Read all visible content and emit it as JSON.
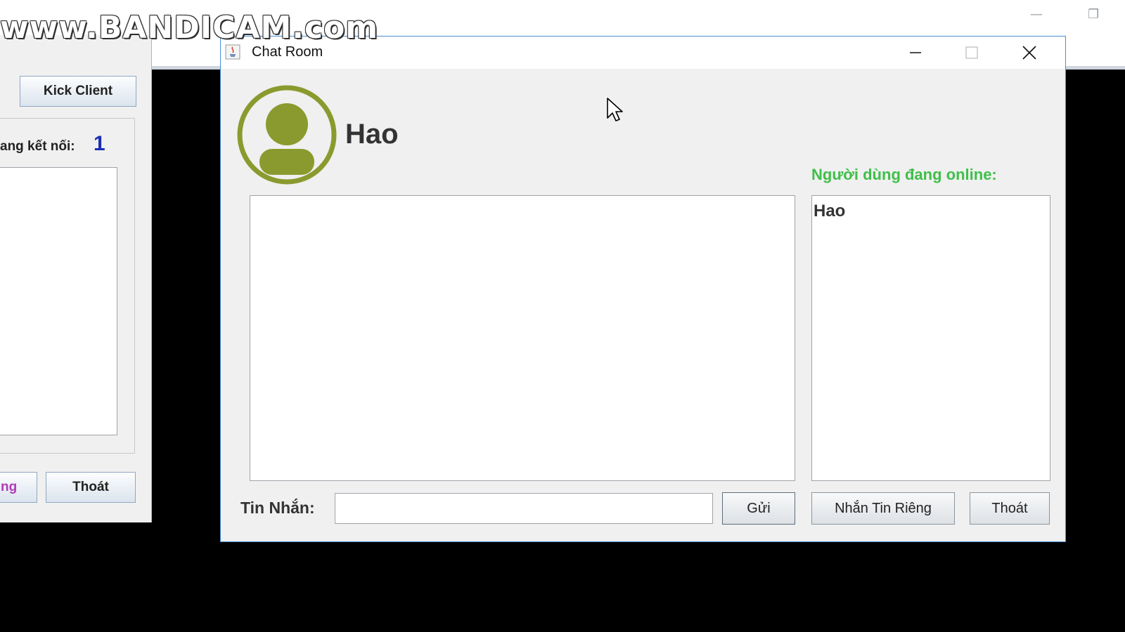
{
  "watermark": "www.BANDICAM.com",
  "background_window": {
    "minimize_glyph": "—",
    "restore_glyph": "❐"
  },
  "server_window": {
    "kick_button": "Kick Client",
    "connected_label": "ang kết nối:",
    "connected_count": "1",
    "partial_button": "ng",
    "exit_button": "Thoát"
  },
  "chat_window": {
    "title": "Chat Room",
    "username": "Hao",
    "online_title": "Người dùng đang online:",
    "online_users": [
      "Hao"
    ],
    "message_label": "Tin Nhắn:",
    "message_value": "",
    "send_button": "Gửi",
    "private_button": "Nhắn Tin Riêng",
    "exit_button": "Thoát",
    "avatar_color": "#8b9a2e"
  }
}
